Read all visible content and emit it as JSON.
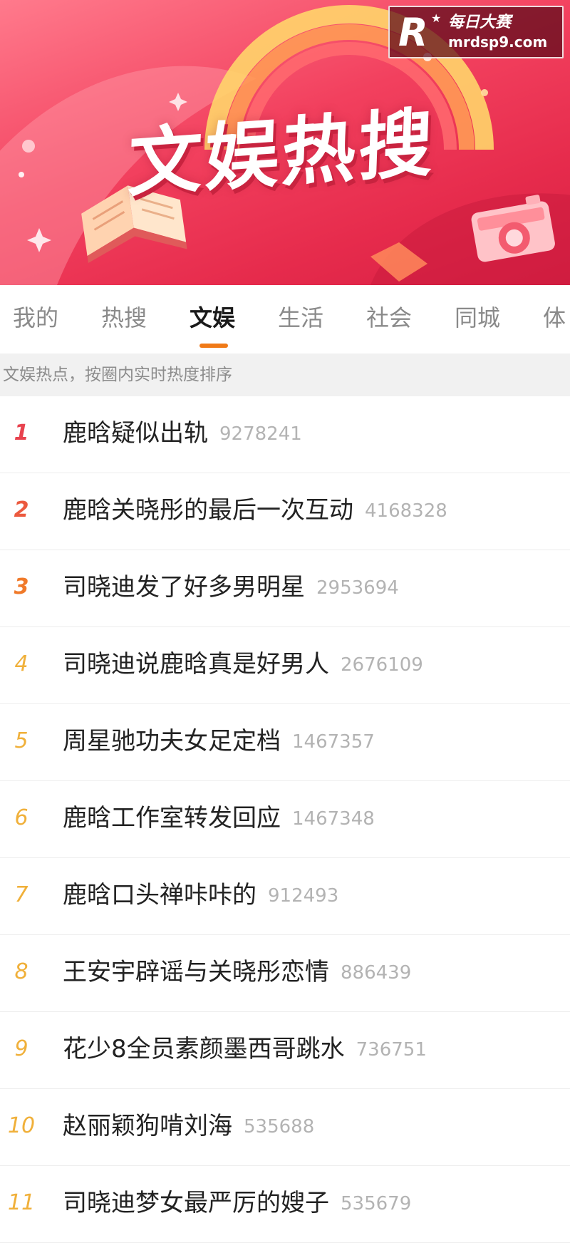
{
  "banner": {
    "title": "文娱热搜"
  },
  "watermark": {
    "logo_letter": "R",
    "name": "每日大赛",
    "url": "mrdsp9.com"
  },
  "tabs": [
    {
      "label": "我的",
      "active": false
    },
    {
      "label": "热搜",
      "active": false
    },
    {
      "label": "文娱",
      "active": true
    },
    {
      "label": "生活",
      "active": false
    },
    {
      "label": "社会",
      "active": false
    },
    {
      "label": "同城",
      "active": false
    },
    {
      "label": "体",
      "active": false
    }
  ],
  "hint": "文娱热点，按圈内实时热度排序",
  "list": [
    {
      "rank": "1",
      "topic": "鹿晗疑似出轨",
      "heat": "9278241"
    },
    {
      "rank": "2",
      "topic": "鹿晗关晓彤的最后一次互动",
      "heat": "4168328"
    },
    {
      "rank": "3",
      "topic": "司晓迪发了好多男明星",
      "heat": "2953694"
    },
    {
      "rank": "4",
      "topic": "司晓迪说鹿晗真是好男人",
      "heat": "2676109"
    },
    {
      "rank": "5",
      "topic": "周星驰功夫女足定档",
      "heat": "1467357"
    },
    {
      "rank": "6",
      "topic": "鹿晗工作室转发回应",
      "heat": "1467348"
    },
    {
      "rank": "7",
      "topic": "鹿晗口头禅咔咔的",
      "heat": "912493"
    },
    {
      "rank": "8",
      "topic": "王安宇辟谣与关晓彤恋情",
      "heat": "886439"
    },
    {
      "rank": "9",
      "topic": "花少8全员素颜墨西哥跳水",
      "heat": "736751"
    },
    {
      "rank": "10",
      "topic": "赵丽颖狗啃刘海",
      "heat": "535688"
    },
    {
      "rank": "11",
      "topic": "司晓迪梦女最严厉的嫂子",
      "heat": "535679"
    }
  ],
  "colors": {
    "rank_top": "#e8424e",
    "rank_mid": "#f07a2a",
    "rank_rest": "#f0b03a",
    "tab_indicator": "#f07a18",
    "banner": "#f2405e"
  }
}
